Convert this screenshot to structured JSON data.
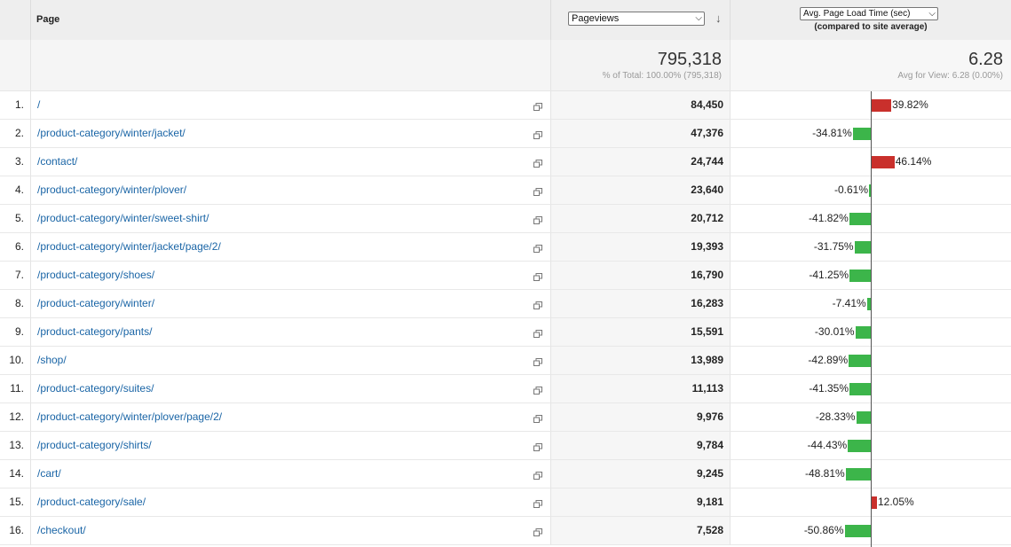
{
  "header": {
    "page_label": "Page",
    "metric_select": "Pageviews",
    "compare_select": "Avg. Page Load Time (sec)",
    "compare_sub": "(compared to site average)"
  },
  "summary": {
    "pageviews_total": "795,318",
    "pageviews_pct": "% of Total: 100.00% (795,318)",
    "avg_value": "6.28",
    "avg_for_view": "Avg for View: 6.28 (0.00%)"
  },
  "colors": {
    "positive_bar": "#c9302c",
    "negative_bar": "#3cb54a",
    "link": "#1a65a6"
  },
  "rows": [
    {
      "idx": "1.",
      "page": "/",
      "pageviews": "84,450",
      "delta": "39.82%",
      "value": 39.82
    },
    {
      "idx": "2.",
      "page": "/product-category/winter/jacket/",
      "pageviews": "47,376",
      "delta": "-34.81%",
      "value": -34.81
    },
    {
      "idx": "3.",
      "page": "/contact/",
      "pageviews": "24,744",
      "delta": "46.14%",
      "value": 46.14
    },
    {
      "idx": "4.",
      "page": "/product-category/winter/plover/",
      "pageviews": "23,640",
      "delta": "-0.61%",
      "value": -0.61
    },
    {
      "idx": "5.",
      "page": "/product-category/winter/sweet-shirt/",
      "pageviews": "20,712",
      "delta": "-41.82%",
      "value": -41.82
    },
    {
      "idx": "6.",
      "page": "/product-category/winter/jacket/page/2/",
      "pageviews": "19,393",
      "delta": "-31.75%",
      "value": -31.75
    },
    {
      "idx": "7.",
      "page": "/product-category/shoes/",
      "pageviews": "16,790",
      "delta": "-41.25%",
      "value": -41.25
    },
    {
      "idx": "8.",
      "page": "/product-category/winter/",
      "pageviews": "16,283",
      "delta": "-7.41%",
      "value": -7.41
    },
    {
      "idx": "9.",
      "page": "/product-category/pants/",
      "pageviews": "15,591",
      "delta": "-30.01%",
      "value": -30.01
    },
    {
      "idx": "10.",
      "page": "/shop/",
      "pageviews": "13,989",
      "delta": "-42.89%",
      "value": -42.89
    },
    {
      "idx": "11.",
      "page": "/product-category/suites/",
      "pageviews": "11,113",
      "delta": "-41.35%",
      "value": -41.35
    },
    {
      "idx": "12.",
      "page": "/product-category/winter/plover/page/2/",
      "pageviews": "9,976",
      "delta": "-28.33%",
      "value": -28.33
    },
    {
      "idx": "13.",
      "page": "/product-category/shirts/",
      "pageviews": "9,784",
      "delta": "-44.43%",
      "value": -44.43
    },
    {
      "idx": "14.",
      "page": "/cart/",
      "pageviews": "9,245",
      "delta": "-48.81%",
      "value": -48.81
    },
    {
      "idx": "15.",
      "page": "/product-category/sale/",
      "pageviews": "9,181",
      "delta": "12.05%",
      "value": 12.05
    },
    {
      "idx": "16.",
      "page": "/checkout/",
      "pageviews": "7,528",
      "delta": "-50.86%",
      "value": -50.86
    }
  ]
}
